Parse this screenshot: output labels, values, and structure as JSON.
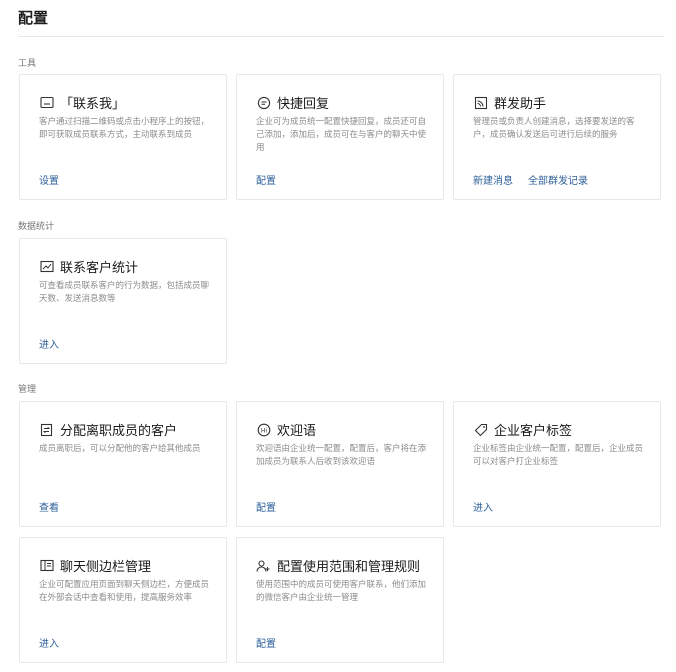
{
  "page": {
    "title": "配置"
  },
  "sections": {
    "tools": {
      "label": "工具"
    },
    "stats": {
      "label": "数据统计"
    },
    "manage": {
      "label": "管理"
    }
  },
  "cards": {
    "contact_me": {
      "title": "「联系我」",
      "icon": "qrcode-window-icon",
      "desc": "客户通过扫描二维码或点击小程序上的按钮，即可获取成员联系方式，主动联系到成员",
      "actions": [
        "设置"
      ]
    },
    "quick_reply": {
      "title": "快捷回复",
      "icon": "chat-bubble-icon",
      "desc": "企业可为成员统一配置快捷回复，成员还可自己添加，添加后，成员可在与客户的聊天中使用",
      "actions": [
        "配置"
      ]
    },
    "mass_send": {
      "title": "群发助手",
      "icon": "broadcast-icon",
      "desc": "管理员或负责人创建消息，选择要发送的客户，成员确认发送后可进行后续的服务",
      "actions": [
        "新建消息",
        "全部群发记录"
      ]
    },
    "customer_stats": {
      "title": "联系客户统计",
      "icon": "chart-icon",
      "desc": "可查看成员联系客户的行为数据，包括成员聊天数、发送消息数等",
      "actions": [
        "进入"
      ]
    },
    "assign_departed": {
      "title": "分配离职成员的客户",
      "icon": "transfer-icon",
      "desc": "成员离职后，可以分配他的客户给其他成员",
      "actions": [
        "查看"
      ]
    },
    "welcome": {
      "title": "欢迎语",
      "icon": "hi-icon",
      "desc": "欢迎语由企业统一配置，配置后，客户将在添加成员为联系人后收到该欢迎语",
      "actions": [
        "配置"
      ]
    },
    "customer_tags": {
      "title": "企业客户标签",
      "icon": "tag-icon",
      "desc": "企业标签由企业统一配置，配置后，企业成员可以对客户打企业标签",
      "actions": [
        "进入"
      ]
    },
    "sidebar_manage": {
      "title": "聊天侧边栏管理",
      "icon": "sidebar-icon",
      "desc": "企业可配置应用页面到聊天侧边栏，方便成员在外部会话中查看和使用，提高服务效率",
      "actions": [
        "进入"
      ]
    },
    "scope_rules": {
      "title": "配置使用范围和管理规则",
      "icon": "add-user-icon",
      "desc": "使用范围中的成员可使用客户联系，他们添加的微信客户由企业统一管理",
      "actions": [
        "配置"
      ]
    }
  }
}
